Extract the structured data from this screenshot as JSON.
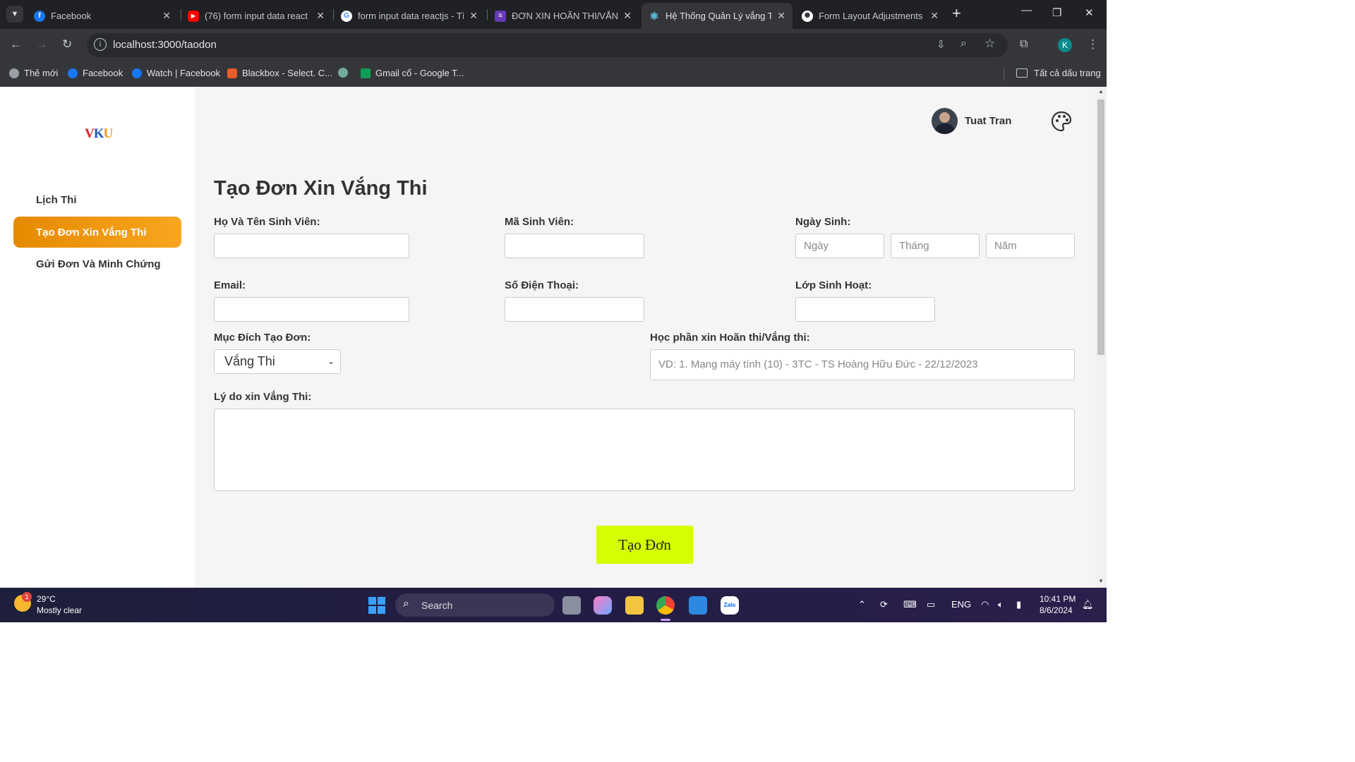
{
  "browser": {
    "tabs": [
      {
        "title": "Facebook",
        "favicon": "facebook-icon",
        "color": "#1877f2",
        "glyph": "f"
      },
      {
        "title": "(76) form input data react",
        "favicon": "youtube-icon",
        "color": "#ff0000",
        "glyph": "▶"
      },
      {
        "title": "form input data reactjs - Tì",
        "favicon": "google-icon",
        "color": "#ffffff",
        "glyph": "G"
      },
      {
        "title": "ĐƠN XIN HOÃN THI/VẮNG",
        "favicon": "forms-icon",
        "color": "#673ab7",
        "glyph": "≡"
      },
      {
        "title": "Hệ Thống Quản Lý vắng Th",
        "favicon": "react-icon",
        "color": "#35363a",
        "glyph": "⚛"
      },
      {
        "title": "Form Layout Adjustments",
        "favicon": "chatgpt-icon",
        "color": "#ffffff",
        "glyph": "✺"
      }
    ],
    "new_tab": "+",
    "url": "localhost:3000/taodon",
    "profile_initial": "K",
    "bookmarks": [
      {
        "label": "Thẻ mới",
        "icon": "globe-icon",
        "color": "#9aa0a6"
      },
      {
        "label": "Facebook",
        "icon": "facebook-icon",
        "color": "#1877f2"
      },
      {
        "label": "Watch | Facebook",
        "icon": "facebook-icon",
        "color": "#1877f2"
      },
      {
        "label": "Blackbox - Select. C...",
        "icon": "blackbox-icon",
        "color": "#e85d2a"
      },
      {
        "label": "",
        "icon": "chatgpt-icon",
        "color": "#74aa9c"
      },
      {
        "label": "Gmail cổ - Google T...",
        "icon": "sheets-icon",
        "color": "#0f9d58"
      }
    ],
    "all_bookmarks": "Tất cả dấu trang"
  },
  "sidebar": {
    "logo": "VKU",
    "items": [
      {
        "label": "Lịch Thi",
        "active": false
      },
      {
        "label": "Tạo Đơn Xin Vắng Thi",
        "active": true
      },
      {
        "label": "Gửi Đơn Và Minh Chứng",
        "active": false
      }
    ]
  },
  "header": {
    "user_name": "Tuat Tran"
  },
  "form": {
    "title": "Tạo Đơn Xin Vắng Thi",
    "full_name_label": "Họ Và Tên Sinh Viên:",
    "student_id_label": "Mã Sinh Viên:",
    "dob_label": "Ngày Sinh:",
    "day_placeholder": "Ngày",
    "month_placeholder": "Tháng",
    "year_placeholder": "Năm",
    "email_label": "Email:",
    "phone_label": "Số Điện Thoại:",
    "class_label": "Lớp Sinh Hoạt:",
    "purpose_label": "Mục Đích Tạo Đơn:",
    "purpose_value": "Vắng Thi",
    "course_label": "Học phần xin Hoãn thi/Vắng thi:",
    "course_placeholder": "VD: 1. Mạng máy tính (10) - 3TC - TS Hoàng Hữu Đức - 22/12/2023",
    "reason_label": "Lý do xin Vắng Thi:",
    "submit_label": "Tạo Đơn"
  },
  "taskbar": {
    "weather_temp": "29°C",
    "weather_desc": "Mostly clear",
    "weather_badge": "1",
    "search_label": "Search",
    "language": "ENG",
    "time": "10:41 PM",
    "date": "8/6/2024"
  },
  "colors": {
    "accent_orange": "#f39c12",
    "submit_bg": "#d4ff00"
  }
}
